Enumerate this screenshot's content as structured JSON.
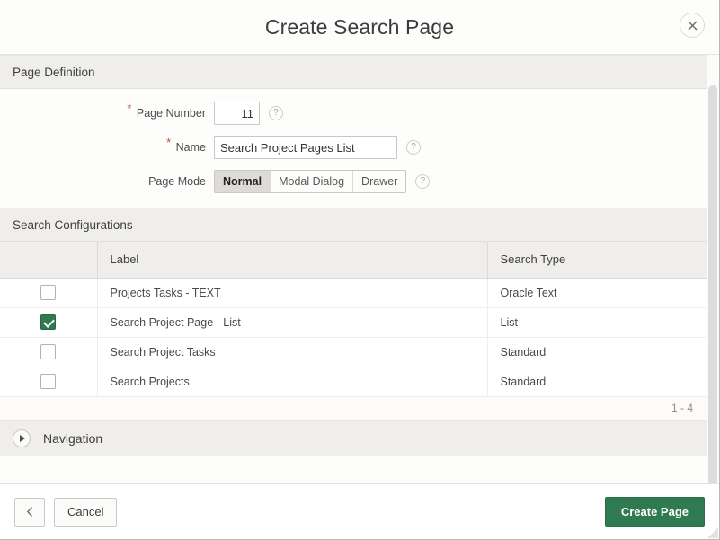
{
  "dialog": {
    "title": "Create Search Page",
    "close_icon": "close-icon"
  },
  "page_definition": {
    "region_title": "Page Definition",
    "fields": {
      "page_number": {
        "label": "Page Number",
        "value": "11",
        "required_marker": "*",
        "help_icon": "?"
      },
      "name": {
        "label": "Name",
        "value": "Search Project Pages List",
        "placeholder": "",
        "required_marker": "*",
        "help_icon": "?"
      },
      "page_mode": {
        "label": "Page Mode",
        "selected": "Normal",
        "options": [
          "Normal",
          "Modal Dialog",
          "Drawer"
        ],
        "help_icon": "?"
      }
    }
  },
  "search_configurations": {
    "region_title": "Search Configurations",
    "columns": [
      "",
      "Label",
      "Search Type"
    ],
    "rows": [
      {
        "checked": false,
        "label": "Projects Tasks - TEXT",
        "search_type": "Oracle Text"
      },
      {
        "checked": true,
        "label": "Search Project Page - List",
        "search_type": "List"
      },
      {
        "checked": false,
        "label": "Search Project Tasks",
        "search_type": "Standard"
      },
      {
        "checked": false,
        "label": "Search Projects",
        "search_type": "Standard"
      }
    ],
    "pagination": "1 - 4"
  },
  "navigation": {
    "region_title": "Navigation",
    "expanded": false,
    "arrow_icon": "triangle-right-icon"
  },
  "footer": {
    "back_icon": "chevron-left-icon",
    "cancel_label": "Cancel",
    "create_label": "Create Page"
  },
  "colors": {
    "primary_green": "#2f7a50",
    "region_header_bg": "#efeeec",
    "required_star": "#c0503a"
  }
}
